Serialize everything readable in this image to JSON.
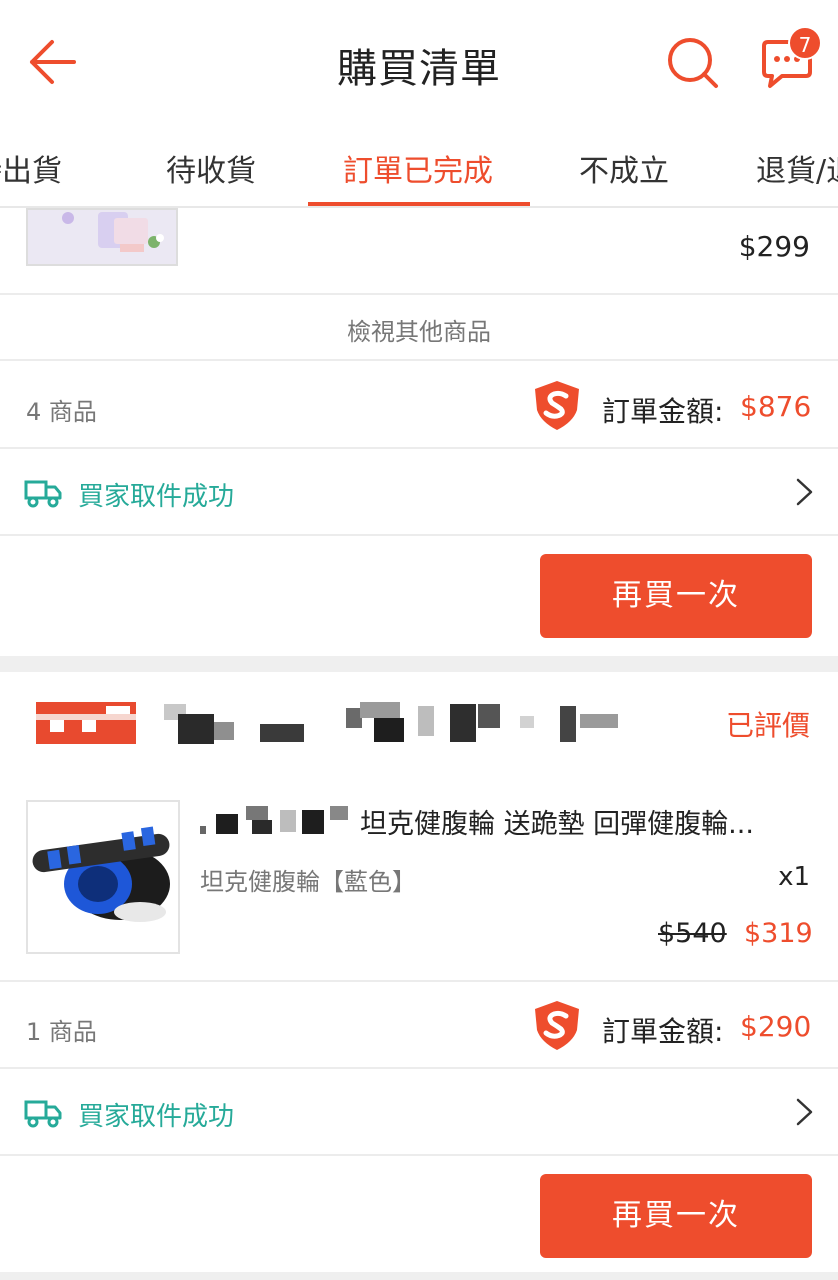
{
  "header": {
    "title": "購買清單",
    "notification_count": "7"
  },
  "tabs": [
    {
      "label": "待出貨"
    },
    {
      "label": "待收貨"
    },
    {
      "label": "訂單已完成"
    },
    {
      "label": "不成立"
    },
    {
      "label": "退貨/退款"
    }
  ],
  "order1": {
    "partial_item_price": "$299",
    "view_more": "檢視其他商品",
    "item_count": "4 商品",
    "total_label": "訂單金額:",
    "total_value": "$876",
    "shipping_status": "買家取件成功",
    "buy_again": "再買一次"
  },
  "order2": {
    "status": "已評價",
    "product": {
      "name": "坦克健腹輪 送跪墊 回彈健腹輪...",
      "variation": "坦克健腹輪【藍色】",
      "quantity": "x1",
      "original_price": "$540",
      "price": "$319"
    },
    "item_count": "1 商品",
    "total_label": "訂單金額:",
    "total_value": "$290",
    "shipping_status": "買家取件成功",
    "buy_again": "再買一次"
  },
  "colors": {
    "accent": "#ee4d2d",
    "shipping": "#26aa99"
  }
}
